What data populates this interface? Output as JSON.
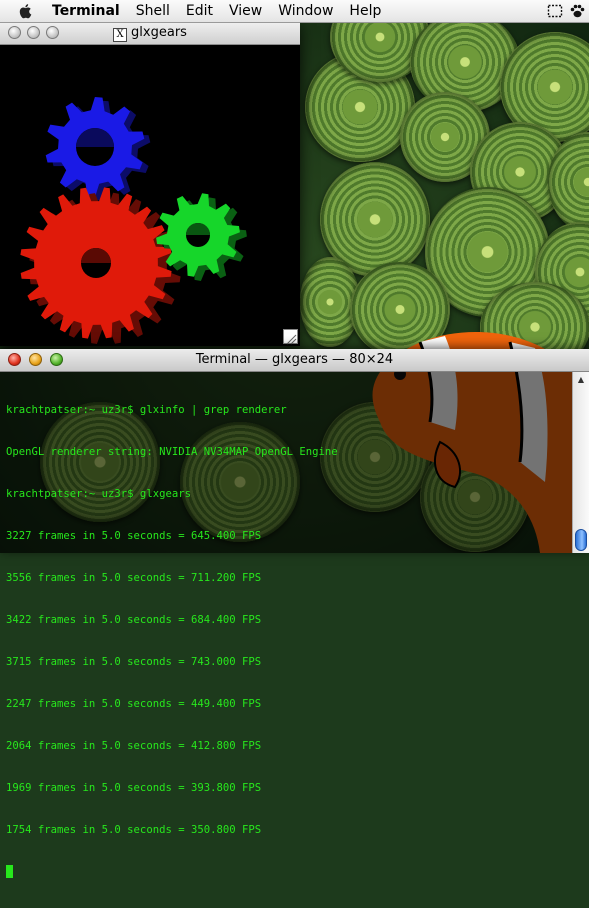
{
  "menubar": {
    "app_name": "Terminal",
    "items": [
      "Shell",
      "Edit",
      "View",
      "Window",
      "Help"
    ],
    "status_icons": [
      "selection-icon",
      "paw-icon"
    ]
  },
  "gears_window": {
    "title": "glxgears",
    "title_icon": "X",
    "gears": [
      {
        "color": "#1a1ae6",
        "name": "blue gear"
      },
      {
        "color": "#e01a0a",
        "name": "red gear"
      },
      {
        "color": "#16d62a",
        "name": "green gear"
      }
    ]
  },
  "terminal_window": {
    "title": "Terminal — glxgears — 80×24",
    "lines": [
      "kracht­patser:~ uz3r$ glxinfo | grep renderer",
      "OpenGL renderer string: NVIDIA NV34MAP OpenGL Engine",
      "krachtpatser:~ uz3r$ glxgears",
      "3227 frames in 5.0 seconds = 645.400 FPS",
      "3556 frames in 5.0 seconds = 711.200 FPS",
      "3422 frames in 5.0 seconds = 684.400 FPS",
      "3715 frames in 5.0 seconds = 743.000 FPS",
      "2247 frames in 5.0 seconds = 449.400 FPS",
      "2064 frames in 5.0 seconds = 412.800 FPS",
      "1969 frames in 5.0 seconds = 393.800 FPS",
      "1754 frames in 5.0 seconds = 350.800 FPS"
    ],
    "text_color": "#27e81c"
  }
}
